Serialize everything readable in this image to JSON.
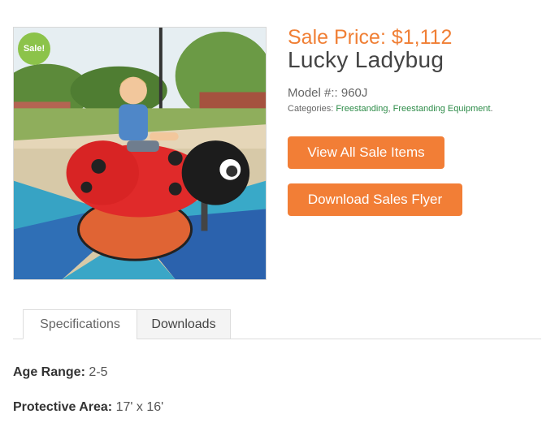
{
  "product": {
    "badge": "Sale!",
    "sale_price": "Sale Price: $1,112",
    "title": "Lucky Ladybug",
    "model": "Model #:: 960J",
    "categories_label": "Categories:",
    "categories": [
      "Freestanding",
      "Freestanding Equipment"
    ],
    "category_separator": ",",
    "category_end": "."
  },
  "buttons": {
    "view_sale": "View All Sale Items",
    "download_flyer": "Download Sales Flyer"
  },
  "tabs": [
    {
      "label": "Specifications",
      "active": true
    },
    {
      "label": "Downloads",
      "active": false
    }
  ],
  "specs": [
    {
      "label": "Age Range:",
      "value": "2-5"
    },
    {
      "label": "Protective Area:",
      "value": "17' x 16'"
    }
  ],
  "colors": {
    "accent": "#f27e36",
    "badge": "#8cc34a",
    "link": "#2e8c49"
  }
}
